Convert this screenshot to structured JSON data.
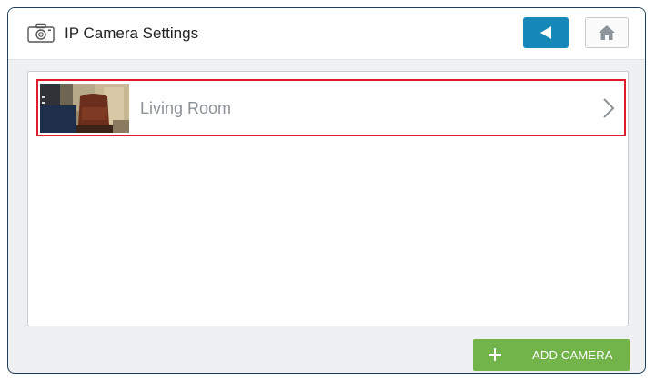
{
  "header": {
    "title": "IP Camera Settings",
    "icon": "camera-icon",
    "back_icon": "back-arrow-icon",
    "home_icon": "home-icon"
  },
  "cameras": [
    {
      "name": "Living Room",
      "selected": true,
      "thumbnail": "living-room-camera-thumbnail"
    }
  ],
  "footer": {
    "add_camera_label": "ADD CAMERA",
    "add_icon": "plus-icon"
  },
  "colors": {
    "accent": "#1789b8",
    "add_button": "#72b34a",
    "selection_border": "#e01b2c"
  }
}
